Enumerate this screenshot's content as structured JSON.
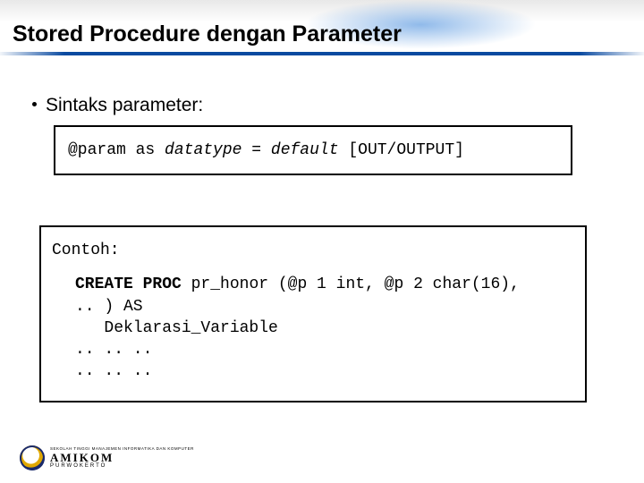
{
  "title": "Stored Procedure dengan Parameter",
  "bullet": {
    "label": "Sintaks parameter:"
  },
  "syntax": {
    "param": "@param",
    "as": "as",
    "datatype": "datatype",
    "eq": "=",
    "default": "default",
    "outopt": "[OUT/OUTPUT]"
  },
  "example": {
    "label": "Contoh:",
    "line1a": "CREATE PROC",
    "line1b": " pr_honor (@p 1 int, @p 2 char(16),",
    "line2": ".. ) AS",
    "line3": "   Deklarasi_Variable",
    "line4": ".. .. ..",
    "line5": ".. .. .."
  },
  "footer": {
    "top": "SEKOLAH TINGGI MANAJEMEN INFORMATIKA DAN KOMPUTER",
    "mid": "AMIKOM",
    "bot": "PURWOKERTO"
  }
}
